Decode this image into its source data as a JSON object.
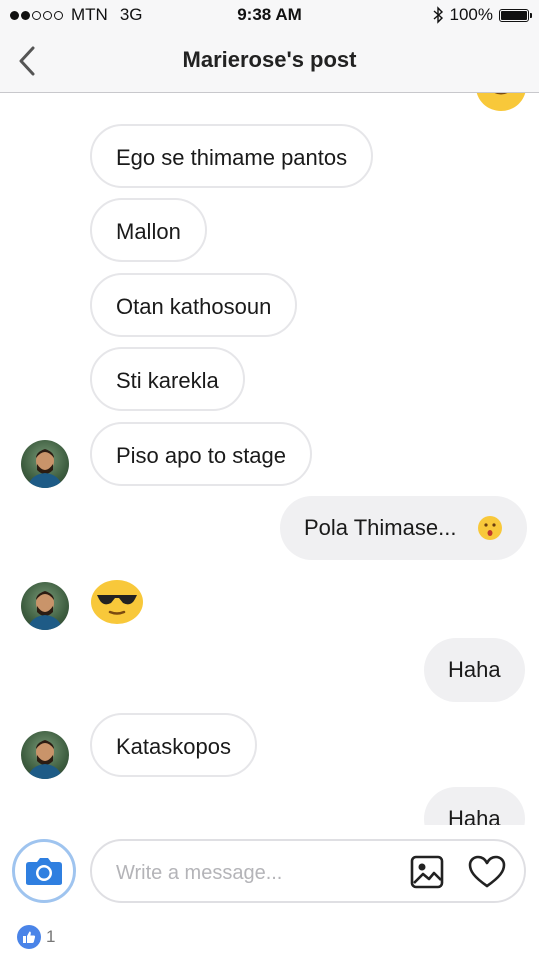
{
  "status_bar": {
    "carrier": "MTN",
    "network": "3G",
    "time": "9:38 AM",
    "battery": "100%",
    "battery_level": 1.0,
    "signal_bars_filled": 2,
    "signal_bars_total": 5
  },
  "nav": {
    "back_icon": "chevron-left-icon",
    "title": "Marierose's post"
  },
  "thread": {
    "messages": [
      {
        "direction": "out",
        "type": "emoji",
        "emoji": "smiling-face-emoji"
      },
      {
        "direction": "in",
        "type": "text",
        "text": "Ego se thimame pantos"
      },
      {
        "direction": "in",
        "type": "text",
        "text": "Mallon"
      },
      {
        "direction": "in",
        "type": "text",
        "text": "Otan kathosoun"
      },
      {
        "direction": "in",
        "type": "text",
        "text": "Sti karekla"
      },
      {
        "direction": "in",
        "type": "text",
        "text": "Piso apo to stage",
        "avatar": true
      },
      {
        "direction": "out",
        "type": "text",
        "text": "Pola Thimase...",
        "emoji": "hushed-face-emoji"
      },
      {
        "direction": "in",
        "type": "emoji",
        "emoji": "sunglasses-emoji",
        "avatar": true
      },
      {
        "direction": "out",
        "type": "text",
        "text": "Haha"
      },
      {
        "direction": "in",
        "type": "text",
        "text": "Kataskopos",
        "avatar": true
      },
      {
        "direction": "out",
        "type": "text",
        "text": "Haha"
      }
    ]
  },
  "composer": {
    "camera_icon": "camera-icon",
    "placeholder": "Write a message...",
    "value": "",
    "gallery_icon": "image-icon",
    "like_icon": "heart-icon"
  },
  "footer": {
    "like_icon": "thumbs-up-icon",
    "like_count": "1"
  },
  "colors": {
    "accent": "#4a84e8",
    "camera_blue": "#2f7fe0",
    "emoji_yellow": "#f8c83a",
    "outgoing_bubble": "#f0f0f2",
    "incoming_border": "#e6e6e9"
  }
}
